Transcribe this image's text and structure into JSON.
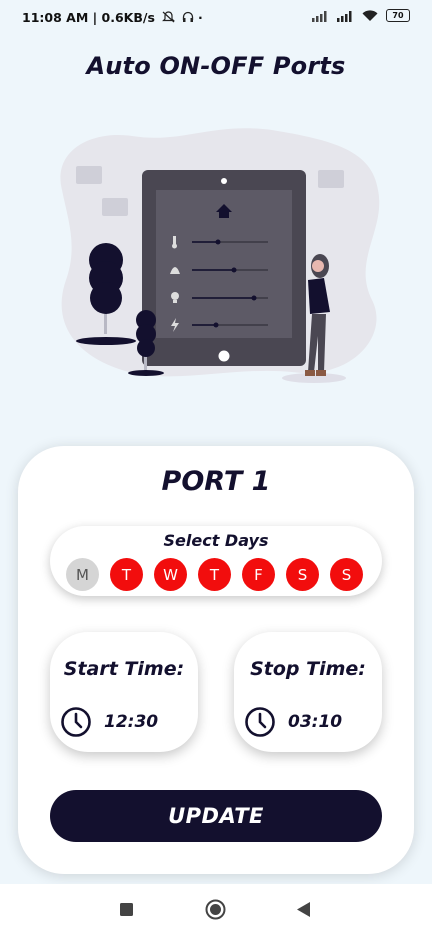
{
  "status_bar": {
    "time_info": "11:08 AM | 0.6KB/s",
    "battery": "70"
  },
  "app_title": "Auto ON-OFF Ports",
  "port": {
    "title": "PORT 1",
    "select_days_label": "Select Days",
    "days": [
      {
        "label": "M",
        "active": false
      },
      {
        "label": "T",
        "active": true
      },
      {
        "label": "W",
        "active": true
      },
      {
        "label": "T",
        "active": true
      },
      {
        "label": "F",
        "active": true
      },
      {
        "label": "S",
        "active": true
      },
      {
        "label": "S",
        "active": true
      }
    ],
    "start": {
      "label": "Start Time:",
      "value": "12:30"
    },
    "stop": {
      "label": "Stop Time:",
      "value": "03:10"
    },
    "update_label": "UPDATE"
  },
  "colors": {
    "primary": "#13102e",
    "day_active": "#f20d0d",
    "day_inactive": "#d5d5d5",
    "background": "#eef6fb"
  },
  "icons": [
    "mute-icon",
    "headset-icon",
    "signal-icon",
    "wifi-icon",
    "battery-icon",
    "clock-icon",
    "recent-apps-icon",
    "home-icon",
    "back-icon"
  ]
}
